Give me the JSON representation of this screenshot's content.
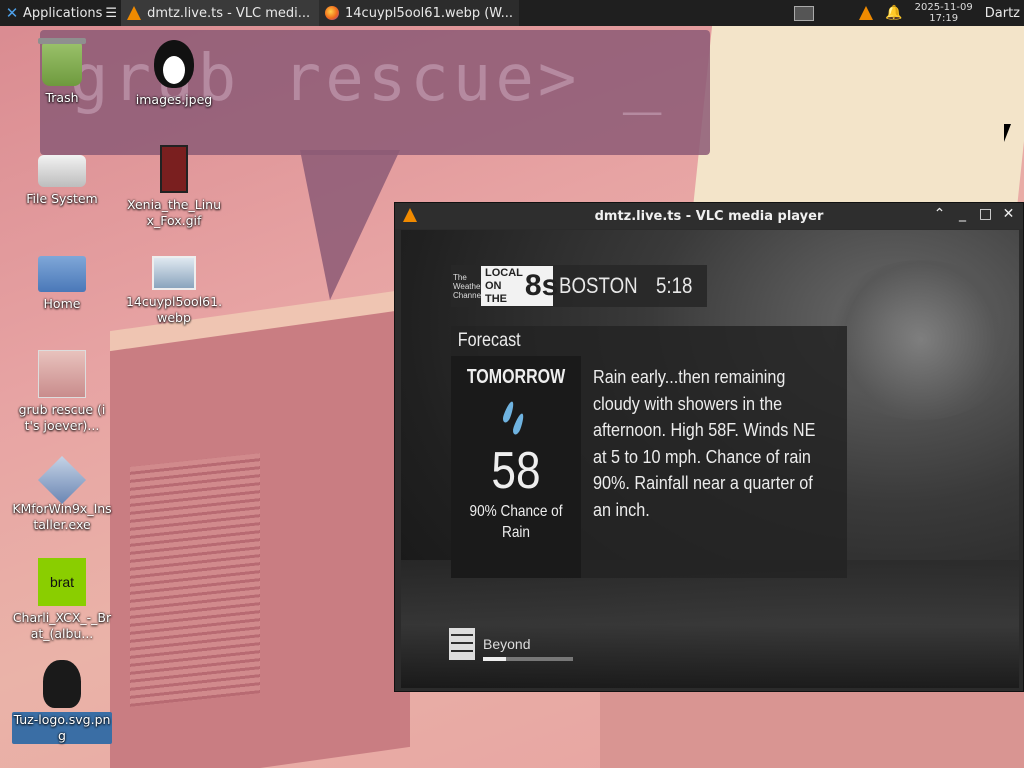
{
  "panel": {
    "apps_label": "Applications",
    "tasks": [
      {
        "label": "dmtz.live.ts - VLC medi...",
        "active": true
      },
      {
        "label": "14cuypl5ool61.webp (W...",
        "active": false
      }
    ],
    "clock_date": "2025-11-09",
    "clock_time": "17:19",
    "user": "Dartz"
  },
  "wallpaper": {
    "text": "grub rescue> _"
  },
  "desktop_icons": [
    {
      "label": "Trash",
      "icon": "trash-icon"
    },
    {
      "label": "images.jpeg",
      "icon": "image-icon"
    },
    {
      "label": "File System",
      "icon": "drive-icon"
    },
    {
      "label": "Xenia_the_Linux_Fox.gif",
      "icon": "image-icon"
    },
    {
      "label": "Home",
      "icon": "home-folder-icon"
    },
    {
      "label": "14cuypl5ool61.webp",
      "icon": "image-icon"
    },
    {
      "label": "grub rescue (it's joever)...",
      "icon": "image-icon"
    },
    {
      "label": "KMforWin9x_Installer.exe",
      "icon": "executable-icon"
    },
    {
      "label": "Charli_XCX_-_Brat_(albu...",
      "icon": "image-icon"
    },
    {
      "label": "Tuz-logo.svg.png",
      "icon": "image-icon"
    }
  ],
  "vlc": {
    "title": "dmtz.live.ts - VLC media player",
    "broadcast": {
      "brand_small": [
        "The",
        "Weather",
        "Channel"
      ],
      "brand_logo_words": [
        "LOCAL",
        "ON THE"
      ],
      "brand_logo_num": "8s",
      "city": "BOSTON",
      "time": "5:18",
      "forecast_title": "Forecast",
      "day": "TOMORROW",
      "temp": "58",
      "chance": "90% Chance of Rain",
      "description": "Rain early...then remaining cloudy with showers in the afternoon. High 58F. Winds NE at 5 to 10 mph. Chance of rain 90%. Rainfall near a quarter of an inch.",
      "beyond_label": "Beyond",
      "beyond_progress": 0.25
    }
  }
}
